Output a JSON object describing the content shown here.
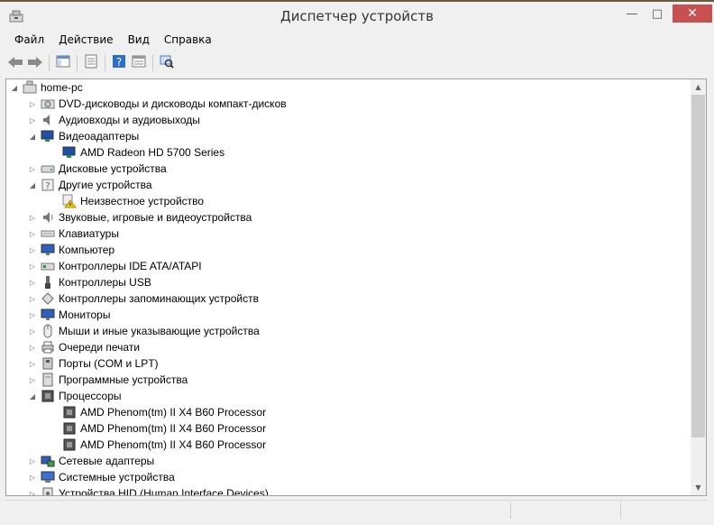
{
  "window": {
    "title": "Диспетчер устройств",
    "min_glyph": "—",
    "max_glyph": "□",
    "close_glyph": "✕"
  },
  "menu": [
    "Файл",
    "Действие",
    "Вид",
    "Справка"
  ],
  "toolbar": [
    "back-icon",
    "forward-icon",
    "show-hide-tree-icon",
    "properties-icon",
    "help-icon",
    "view-icon",
    "scan-hardware-icon"
  ],
  "colors": {
    "close_button": "#c75050",
    "accent": "#2a6fc9"
  },
  "tree": [
    {
      "level": 0,
      "expander": "expanded",
      "icon": "computer-icon",
      "label": "home-pc"
    },
    {
      "level": 1,
      "expander": "collapsed",
      "icon": "dvd-drive-icon",
      "label": "DVD-дисководы и дисководы компакт-дисков"
    },
    {
      "level": 1,
      "expander": "collapsed",
      "icon": "audio-icon",
      "label": "Аудиовходы и аудиовыходы"
    },
    {
      "level": 1,
      "expander": "expanded",
      "icon": "display-adapter-icon",
      "label": "Видеоадаптеры"
    },
    {
      "level": 2,
      "expander": "none",
      "icon": "display-adapter-icon",
      "label": "AMD Radeon HD 5700 Series"
    },
    {
      "level": 1,
      "expander": "collapsed",
      "icon": "disk-drive-icon",
      "label": "Дисковые устройства"
    },
    {
      "level": 1,
      "expander": "expanded",
      "icon": "other-devices-icon",
      "label": "Другие устройства"
    },
    {
      "level": 2,
      "expander": "none",
      "icon": "unknown-device-warning-icon",
      "label": "Неизвестное устройство"
    },
    {
      "level": 1,
      "expander": "collapsed",
      "icon": "sound-icon",
      "label": "Звуковые, игровые и видеоустройства"
    },
    {
      "level": 1,
      "expander": "collapsed",
      "icon": "keyboard-icon",
      "label": "Клавиатуры"
    },
    {
      "level": 1,
      "expander": "collapsed",
      "icon": "monitor-icon",
      "label": "Компьютер"
    },
    {
      "level": 1,
      "expander": "collapsed",
      "icon": "ide-controller-icon",
      "label": "Контроллеры IDE ATA/ATAPI"
    },
    {
      "level": 1,
      "expander": "collapsed",
      "icon": "usb-icon",
      "label": "Контроллеры USB"
    },
    {
      "level": 1,
      "expander": "collapsed",
      "icon": "storage-controller-icon",
      "label": "Контроллеры запоминающих устройств"
    },
    {
      "level": 1,
      "expander": "collapsed",
      "icon": "monitor-icon",
      "label": "Мониторы"
    },
    {
      "level": 1,
      "expander": "collapsed",
      "icon": "mouse-icon",
      "label": "Мыши и иные указывающие устройства"
    },
    {
      "level": 1,
      "expander": "collapsed",
      "icon": "printer-icon",
      "label": "Очереди печати"
    },
    {
      "level": 1,
      "expander": "collapsed",
      "icon": "port-icon",
      "label": "Порты (COM и LPT)"
    },
    {
      "level": 1,
      "expander": "collapsed",
      "icon": "software-device-icon",
      "label": "Программные устройства"
    },
    {
      "level": 1,
      "expander": "expanded",
      "icon": "processor-icon",
      "label": "Процессоры"
    },
    {
      "level": 2,
      "expander": "none",
      "icon": "processor-icon",
      "label": "AMD Phenom(tm) II X4 B60 Processor"
    },
    {
      "level": 2,
      "expander": "none",
      "icon": "processor-icon",
      "label": "AMD Phenom(tm) II X4 B60 Processor"
    },
    {
      "level": 2,
      "expander": "none",
      "icon": "processor-icon",
      "label": "AMD Phenom(tm) II X4 B60 Processor"
    },
    {
      "level": 1,
      "expander": "collapsed",
      "icon": "network-adapter-icon",
      "label": "Сетевые адаптеры"
    },
    {
      "level": 1,
      "expander": "collapsed",
      "icon": "system-device-icon",
      "label": "Системные устройства"
    },
    {
      "level": 1,
      "expander": "collapsed",
      "icon": "hid-icon",
      "label": "Устройства HID (Human Interface Devices)"
    }
  ]
}
